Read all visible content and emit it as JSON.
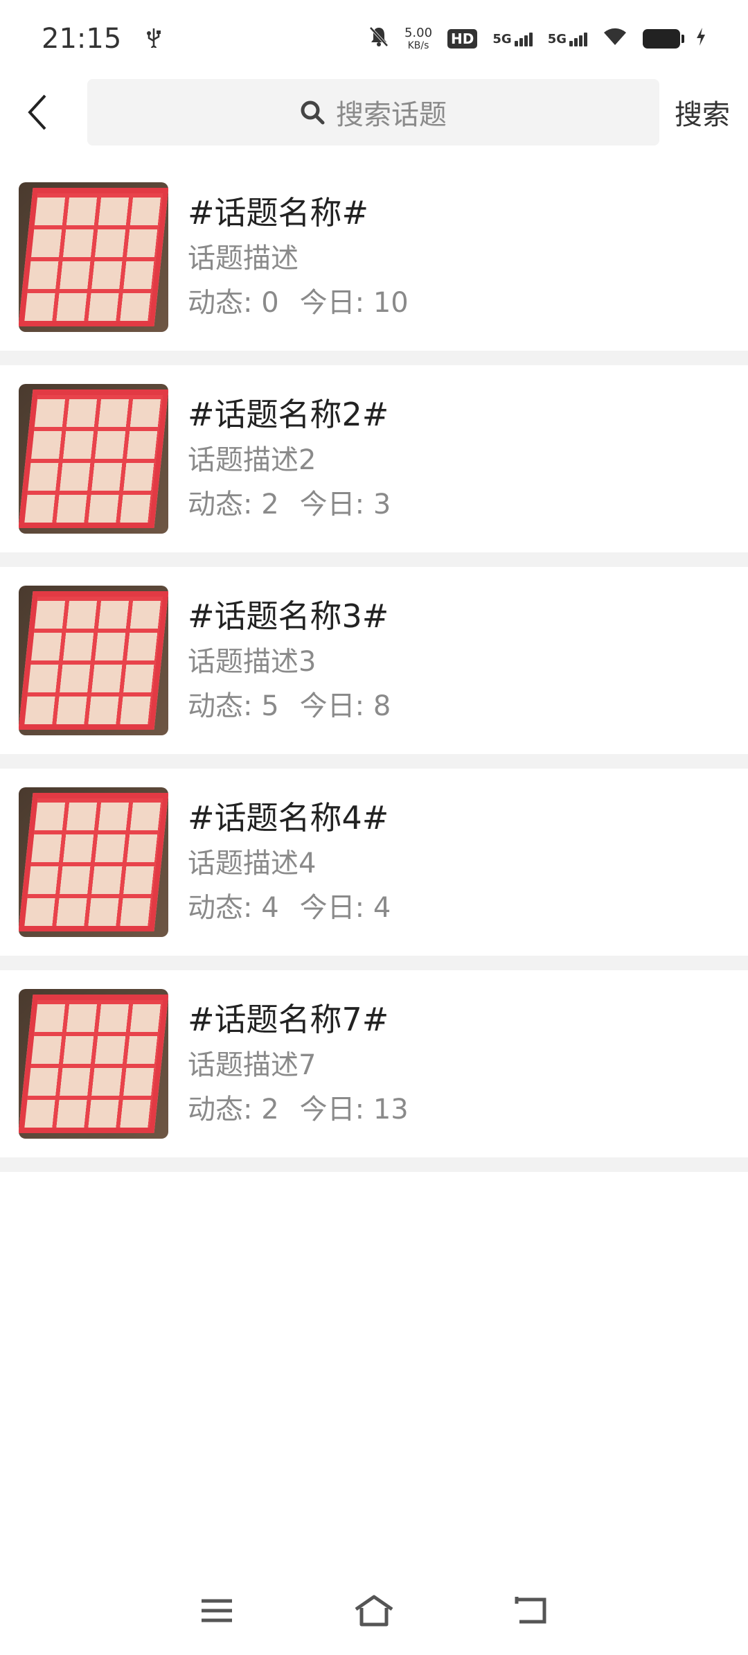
{
  "status_bar": {
    "time": "21:15",
    "net_speed": "5.00",
    "net_unit": "KB/s",
    "hd": "HD",
    "sim1": "5G",
    "sim2": "5G"
  },
  "header": {
    "search_placeholder": "搜索话题",
    "search_button": "搜索"
  },
  "topics": [
    {
      "title": "#话题名称#",
      "desc": "话题描述",
      "posts": "动态: 0",
      "today": "今日: 10"
    },
    {
      "title": "#话题名称2#",
      "desc": "话题描述2",
      "posts": "动态: 2",
      "today": "今日: 3"
    },
    {
      "title": "#话题名称3#",
      "desc": "话题描述3",
      "posts": "动态: 5",
      "today": "今日: 8"
    },
    {
      "title": "#话题名称4#",
      "desc": "话题描述4",
      "posts": "动态: 4",
      "today": "今日: 4"
    },
    {
      "title": "#话题名称7#",
      "desc": "话题描述7",
      "posts": "动态: 2",
      "today": "今日: 13"
    }
  ]
}
